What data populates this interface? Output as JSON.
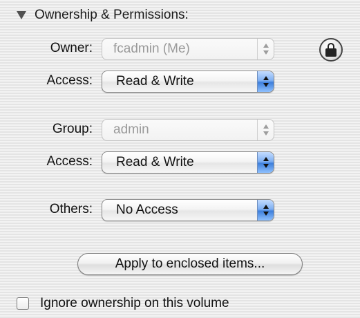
{
  "section": {
    "title": "Ownership & Permissions:"
  },
  "owner": {
    "label": "Owner:",
    "value": "fcadmin (Me)",
    "access_label": "Access:",
    "access_value": "Read & Write"
  },
  "group": {
    "label": "Group:",
    "value": "admin",
    "access_label": "Access:",
    "access_value": "Read & Write"
  },
  "others": {
    "label": "Others:",
    "value": "No Access"
  },
  "apply_button": {
    "label": "Apply to enclosed items..."
  },
  "ignore_ownership": {
    "label": "Ignore ownership on this volume",
    "checked": false
  },
  "icons": {
    "disclosure": "disclosure-triangle-icon",
    "lock": "lock-icon"
  }
}
